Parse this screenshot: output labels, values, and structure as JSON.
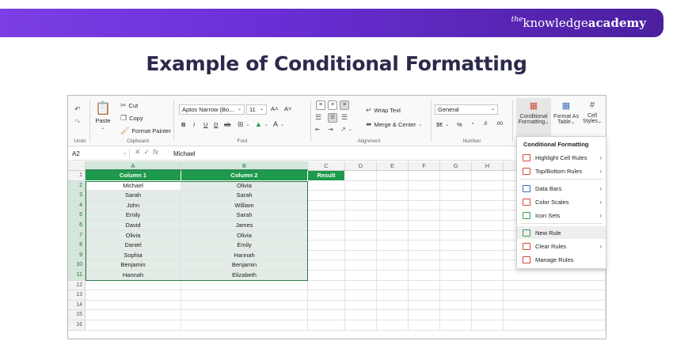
{
  "brand": {
    "the": "the",
    "knowledge": "knowledge",
    "academy": "academy"
  },
  "headline": "Example of Conditional Formatting",
  "ribbon": {
    "undo": {
      "undo_label": "Undo"
    },
    "clipboard": {
      "paste": "Paste",
      "cut": "Cut",
      "copy": "Copy",
      "format_painter": "Format Painter",
      "group": "Clipboard"
    },
    "font": {
      "name": "Aptos Narrow (Bo...",
      "size": "11",
      "grow": "A˄",
      "shrink": "A˅",
      "bold": "B",
      "italic": "I",
      "underline": "U",
      "double_underline": "D",
      "strike": "ab",
      "group": "Font"
    },
    "alignment": {
      "wrap_text": "Wrap Text",
      "merge_center": "Merge & Center",
      "group": "Alignment"
    },
    "number": {
      "format": "General",
      "currency": "$€",
      "percent": "%",
      "comma": "’",
      "inc_decimal": ".0",
      "dec_decimal": ".00",
      "group": "Number"
    },
    "styles": {
      "conditional_line1": "Conditional",
      "conditional_line2": "Formatting",
      "format_table_line1": "Format As",
      "format_table_line2": "Table",
      "cell_styles_line1": "Cell",
      "cell_styles_line2": "Styles"
    }
  },
  "formula_bar": {
    "name_box": "A2",
    "fx": "fx",
    "value": "Michael"
  },
  "grid": {
    "columns": [
      "A",
      "B",
      "C",
      "D",
      "E",
      "F",
      "G",
      "H"
    ],
    "rows": [
      "1",
      "2",
      "3",
      "4",
      "5",
      "6",
      "7",
      "8",
      "9",
      "10",
      "11",
      "12",
      "13",
      "14",
      "15",
      "16"
    ],
    "header": {
      "col1": "Column 1",
      "col2": "Column 2",
      "result": "Result"
    },
    "data": [
      [
        "Michael",
        "Olivia"
      ],
      [
        "Sarah",
        "Sarah"
      ],
      [
        "John",
        "William"
      ],
      [
        "Emily",
        "Sarah"
      ],
      [
        "David",
        "James"
      ],
      [
        "Olivia",
        "Olivia"
      ],
      [
        "Daniel",
        "Emily"
      ],
      [
        "Sophia",
        "Hannah"
      ],
      [
        "Benjamin",
        "Benjamin"
      ],
      [
        "Hannah",
        "Elizabeth"
      ]
    ]
  },
  "menu": {
    "title": "Conditional Formatting",
    "items": [
      {
        "label": "Highlight Cell Rules",
        "submenu": true,
        "icon_color": "#d04a3c"
      },
      {
        "label": "Top/Bottom Rules",
        "submenu": true,
        "icon_color": "#d04a3c"
      },
      {
        "label": "Data Bars",
        "submenu": true,
        "icon_color": "#3b6fb6"
      },
      {
        "label": "Color Scales",
        "submenu": true,
        "icon_color": "#d04a3c"
      },
      {
        "label": "Icon Sets",
        "submenu": true,
        "icon_color": "#3b9a4a"
      },
      {
        "label": "New Rule",
        "submenu": false,
        "icon_color": "#3b9a4a"
      },
      {
        "label": "Clear Rules",
        "submenu": true,
        "icon_color": "#d04a3c"
      },
      {
        "label": "Manage Rules",
        "submenu": false,
        "icon_color": "#d04a3c"
      }
    ]
  },
  "colors": {
    "accent_green": "#1e9a4c",
    "brand_purple": "#6a2fd6"
  }
}
